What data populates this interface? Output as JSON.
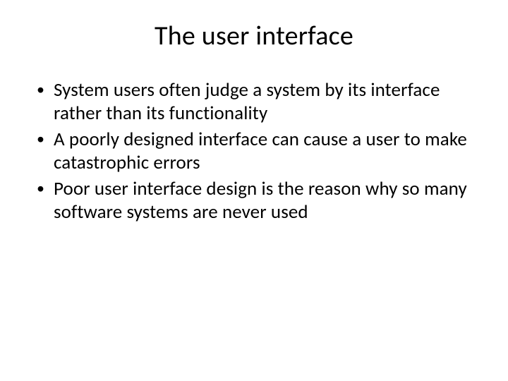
{
  "slide": {
    "title": "The user interface",
    "bullets": [
      "System users often judge a system by its interface rather than its functionality",
      "A poorly designed interface can cause a user to make catastrophic errors",
      "Poor user interface design is the reason why so many software systems are never used"
    ]
  }
}
